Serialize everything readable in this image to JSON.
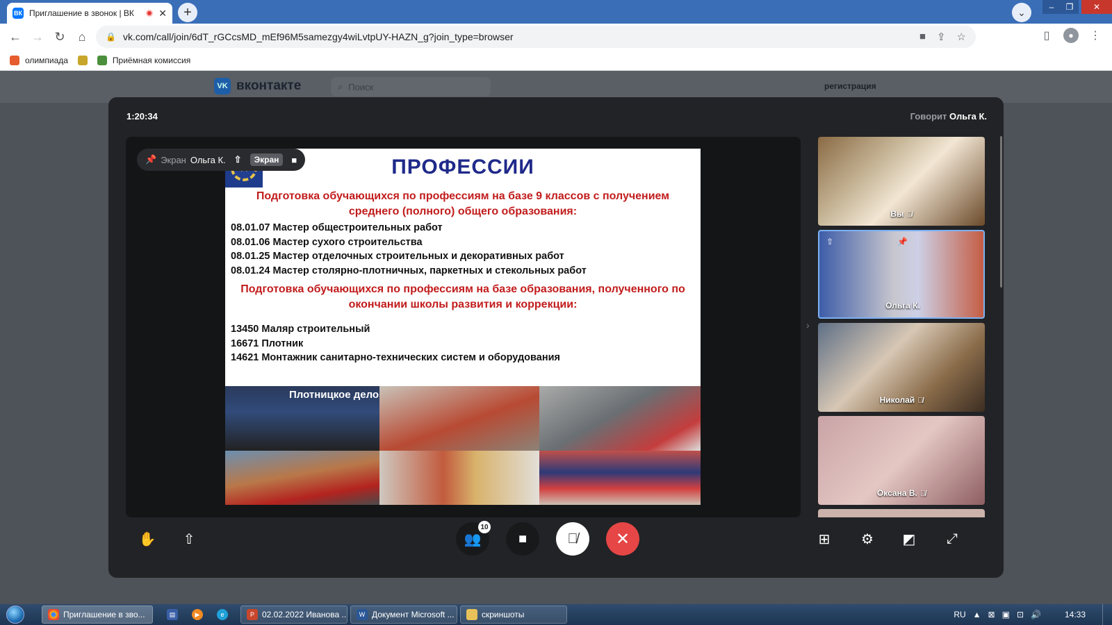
{
  "browser": {
    "tab_title": "Приглашение в звонок | ВК",
    "tab_favicon": "ВК",
    "url": "vk.com/call/join/6dT_rGCcsMD_mEf96M5samezgy4wiLvtpUY-HAZN_g?join_type=browser",
    "bookmarks": [
      {
        "label": "олимпиада",
        "color": "#e65c2e"
      },
      {
        "label": "",
        "color": "#c8a62a"
      },
      {
        "label": "Приёмная комиссия",
        "color": "#4a8f3a"
      }
    ]
  },
  "vk": {
    "logo_text": "вконтакте",
    "search_placeholder": "Поиск",
    "register_link": "регистрация"
  },
  "call": {
    "timer": "1:20:34",
    "speaking_prefix": "Говорит",
    "speaking_name": "Ольга К.",
    "pin_label": {
      "screen_word": "Экран",
      "owner_name": "Ольга К.",
      "badge": "Экран"
    },
    "slide": {
      "title": "ПРОФЕССИИ",
      "subtitle1": "Подготовка обучающихся по профессиям на базе  9 классов с получением среднего (полного) общего образования:",
      "list1": [
        "08.01.07 Мастер общестроительных работ",
        "08.01.06 Мастер сухого строительства",
        "08.01.25 Мастер отделочных строительных и декоративных работ",
        "08.01.24 Мастер столярно-плотничных, паркетных и стекольных работ"
      ],
      "subtitle2": "Подготовка обучающихся по профессиям на базе образования, полученного по окончании школы развития и коррекции:",
      "list2": [
        "13450 Маляр строительный",
        "16671 Плотник",
        "14621 Монтажник санитарно-технических систем и оборудования"
      ],
      "photo_caption": "Плотницкое дело"
    },
    "participants": [
      {
        "name": "Вы",
        "muted": true
      },
      {
        "name": "Ольга К.",
        "muted": false,
        "active": true
      },
      {
        "name": "Николай",
        "muted": true
      },
      {
        "name": "Оксана В.",
        "muted": true
      }
    ],
    "participants_count": "10"
  },
  "taskbar": {
    "items": [
      {
        "label": "Приглашение в зво...",
        "active": true
      },
      {
        "label": "02.02.2022 Иванова ..."
      },
      {
        "label": "Документ Microsoft ..."
      },
      {
        "label": "скриншоты"
      }
    ],
    "lang": "RU",
    "clock": "14:33"
  }
}
